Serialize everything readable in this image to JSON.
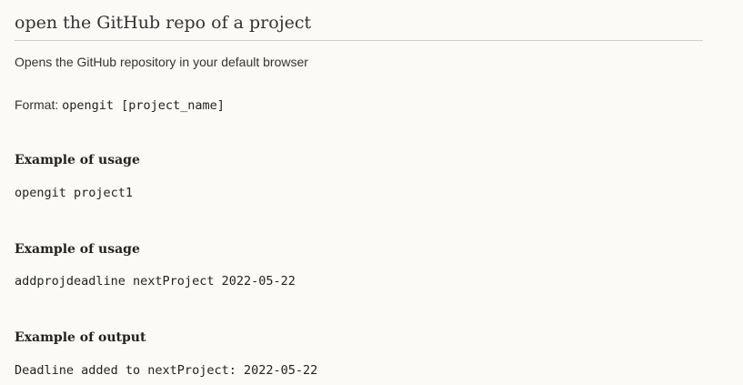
{
  "heading": "open the GitHub repo of a project",
  "description": "Opens the GitHub repository in your default browser",
  "format": {
    "label": "Format:",
    "command": "opengit [project_name]"
  },
  "sections": [
    {
      "title": "Example of usage",
      "code": "opengit project1"
    },
    {
      "title": "Example of usage",
      "code": "addprojdeadline nextProject 2022-05-22"
    },
    {
      "title": "Example of output",
      "code": "Deadline added to nextProject: 2022-05-22"
    }
  ]
}
